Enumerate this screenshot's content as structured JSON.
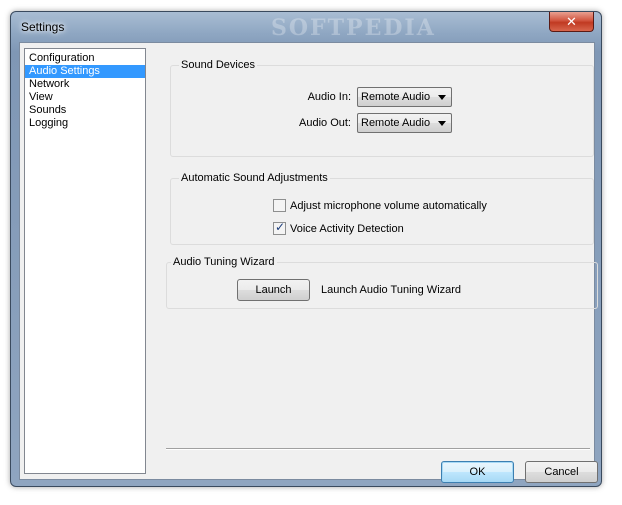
{
  "window": {
    "title": "Settings",
    "watermark": "SOFTPEDIA",
    "close_symbol": "✕"
  },
  "nav": {
    "items": [
      {
        "label": "Configuration",
        "selected": false
      },
      {
        "label": "Audio Settings",
        "selected": true
      },
      {
        "label": "Network",
        "selected": false
      },
      {
        "label": "View",
        "selected": false
      },
      {
        "label": "Sounds",
        "selected": false
      },
      {
        "label": "Logging",
        "selected": false
      }
    ]
  },
  "sound_devices": {
    "title": "Sound Devices",
    "audio_in": {
      "label": "Audio In:",
      "value": "Remote Audio"
    },
    "audio_out": {
      "label": "Audio Out:",
      "value": "Remote Audio"
    }
  },
  "auto_adjust": {
    "title": "Automatic Sound Adjustments",
    "mic_volume": {
      "label": "Adjust microphone volume automatically",
      "checked": false
    },
    "vad": {
      "label": "Voice Activity Detection",
      "checked": true
    }
  },
  "wizard": {
    "title": "Audio Tuning Wizard",
    "launch_label": "Launch",
    "description": "Launch Audio Tuning Wizard"
  },
  "footer": {
    "ok_label": "OK",
    "cancel_label": "Cancel"
  },
  "colors": {
    "selection": "#3399ff",
    "frame": "#8ea6c2",
    "close": "#c03a22"
  }
}
